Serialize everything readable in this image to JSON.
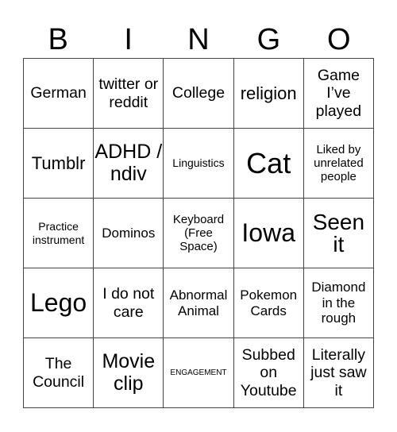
{
  "header": [
    "B",
    "I",
    "N",
    "G",
    "O"
  ],
  "cells": [
    [
      "German",
      "twitter or reddit",
      "College",
      "religion",
      "Game I’ve played"
    ],
    [
      "Tumblr",
      "ADHD / ndiv",
      "Linguistics",
      "Cat",
      "Liked by unrelated people"
    ],
    [
      "Practice instrument",
      "Dominos",
      "Keyboard (Free Space)",
      "Iowa",
      "Seen it"
    ],
    [
      "Lego",
      "I do not care",
      "Abnormal Animal",
      "Pokemon Cards",
      "Diamond in the rough"
    ],
    [
      "The Council",
      "Movie clip",
      "ENGAGEMENT",
      "Subbed on Youtube",
      "Literally just saw it"
    ]
  ]
}
